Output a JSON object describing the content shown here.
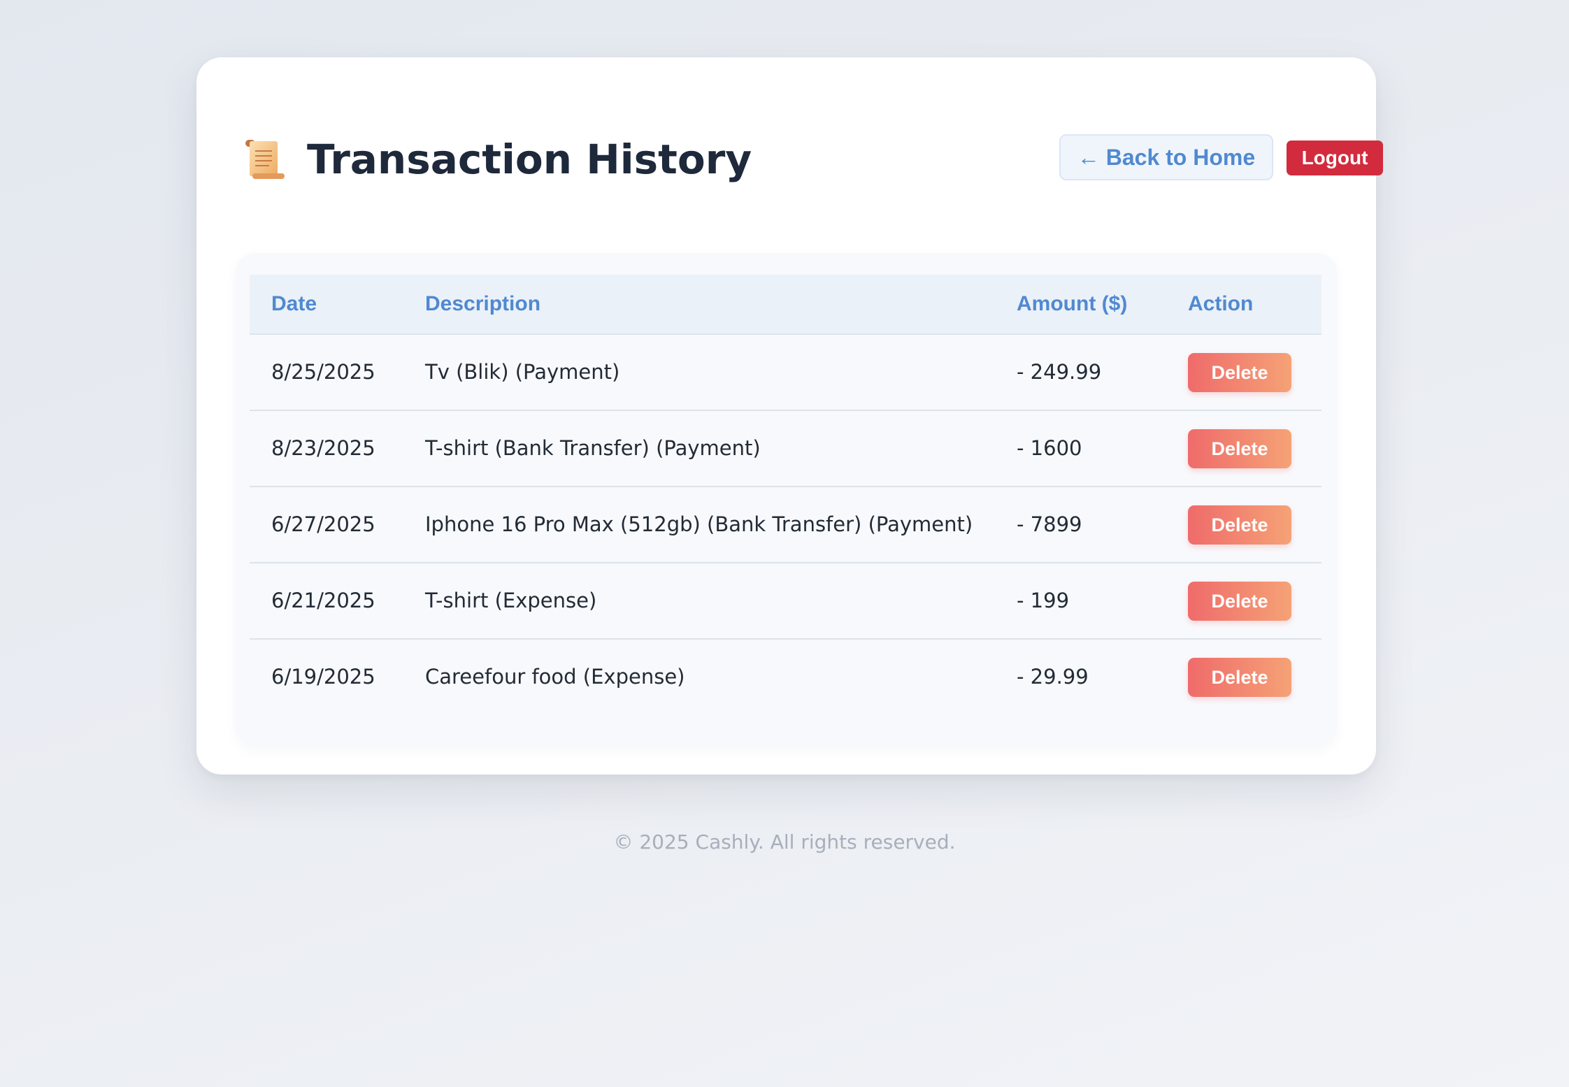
{
  "header": {
    "icon": "scroll-icon",
    "title": "Transaction History",
    "back_label": "← Back to Home",
    "logout_label": "Logout"
  },
  "table": {
    "columns": [
      "Date",
      "Description",
      "Amount ($)",
      "Action"
    ],
    "rows": [
      {
        "date": "8/25/2025",
        "description": "Tv (Blik) (Payment)",
        "amount": "- 249.99",
        "action": "Delete"
      },
      {
        "date": "8/23/2025",
        "description": "T-shirt (Bank Transfer) (Payment)",
        "amount": "- 1600",
        "action": "Delete"
      },
      {
        "date": "6/27/2025",
        "description": "Iphone 16 Pro Max (512gb) (Bank Transfer) (Payment)",
        "amount": "- 7899",
        "action": "Delete"
      },
      {
        "date": "6/21/2025",
        "description": "T-shirt (Expense)",
        "amount": "- 199",
        "action": "Delete"
      },
      {
        "date": "6/19/2025",
        "description": "Careefour food (Expense)",
        "amount": "- 29.99",
        "action": "Delete"
      }
    ]
  },
  "footer": {
    "text": "© 2025 Cashly. All rights reserved."
  },
  "colors": {
    "accent": "#5089d0",
    "logout": "#d22b3d",
    "delete_start": "#ef6b6b",
    "delete_end": "#f5a276",
    "title": "#1e293b"
  }
}
